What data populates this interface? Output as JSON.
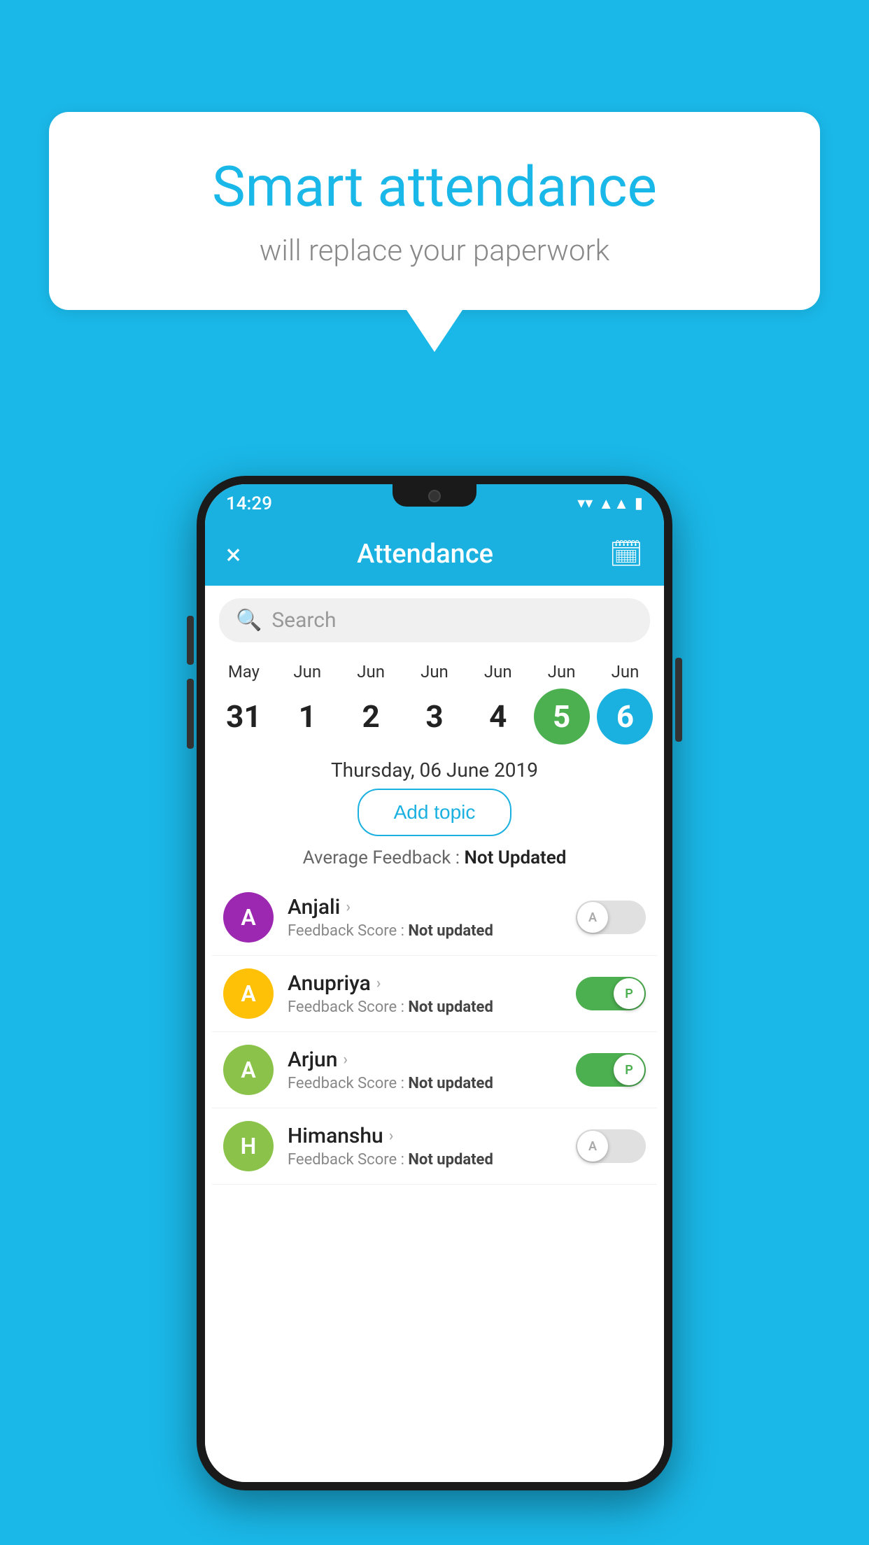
{
  "background_color": "#1ab8e8",
  "speech_bubble": {
    "title": "Smart attendance",
    "subtitle": "will replace your paperwork"
  },
  "status_bar": {
    "time": "14:29",
    "icons": [
      "wifi",
      "signal",
      "battery"
    ]
  },
  "app_bar": {
    "title": "Attendance",
    "close_label": "×",
    "calendar_label": "📅"
  },
  "search": {
    "placeholder": "Search"
  },
  "date_selector": {
    "dates": [
      {
        "month": "May",
        "day": "31",
        "state": "normal"
      },
      {
        "month": "Jun",
        "day": "1",
        "state": "normal"
      },
      {
        "month": "Jun",
        "day": "2",
        "state": "normal"
      },
      {
        "month": "Jun",
        "day": "3",
        "state": "normal"
      },
      {
        "month": "Jun",
        "day": "4",
        "state": "normal"
      },
      {
        "month": "Jun",
        "day": "5",
        "state": "today"
      },
      {
        "month": "Jun",
        "day": "6",
        "state": "selected"
      }
    ]
  },
  "selected_date_label": "Thursday, 06 June 2019",
  "add_topic_button": "Add topic",
  "average_feedback": {
    "label": "Average Feedback : ",
    "value": "Not Updated"
  },
  "students": [
    {
      "name": "Anjali",
      "avatar_letter": "A",
      "avatar_color": "#9C27B0",
      "feedback_label": "Feedback Score : ",
      "feedback_value": "Not updated",
      "toggle_state": "off",
      "toggle_label": "A"
    },
    {
      "name": "Anupriya",
      "avatar_letter": "A",
      "avatar_color": "#FFC107",
      "feedback_label": "Feedback Score : ",
      "feedback_value": "Not updated",
      "toggle_state": "on",
      "toggle_label": "P"
    },
    {
      "name": "Arjun",
      "avatar_letter": "A",
      "avatar_color": "#8BC34A",
      "feedback_label": "Feedback Score : ",
      "feedback_value": "Not updated",
      "toggle_state": "on",
      "toggle_label": "P"
    },
    {
      "name": "Himanshu",
      "avatar_letter": "H",
      "avatar_color": "#8BC34A",
      "feedback_label": "Feedback Score : ",
      "feedback_value": "Not updated",
      "toggle_state": "off",
      "toggle_label": "A"
    }
  ]
}
